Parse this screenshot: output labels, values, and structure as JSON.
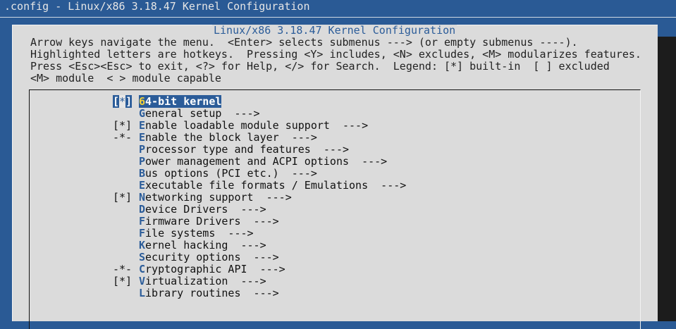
{
  "window": {
    "title": ".config - Linux/x86 3.18.47 Kernel Configuration"
  },
  "dialog": {
    "title": "Linux/x86 3.18.47 Kernel Configuration",
    "help_lines": [
      "Arrow keys navigate the menu.  <Enter> selects submenus ---> (or empty submenus ----).",
      "Highlighted letters are hotkeys.  Pressing <Y> includes, <N> excludes, <M> modularizes features.",
      "Press <Esc><Esc> to exit, <?> for Help, </> for Search.  Legend: [*] built-in  [ ] excluded",
      "<M> module  < > module capable"
    ]
  },
  "menu": {
    "items": [
      {
        "prefix": "[*]",
        "hot": "6",
        "label": "64-bit kernel",
        "suffix": "",
        "selected": true
      },
      {
        "prefix": "",
        "hot": "G",
        "label": "General setup",
        "suffix": "  --->",
        "selected": false
      },
      {
        "prefix": "[*]",
        "hot": "E",
        "label": "Enable loadable module support",
        "suffix": "  --->",
        "selected": false
      },
      {
        "prefix": "-*-",
        "hot": "E",
        "label": "Enable the block layer",
        "suffix": "  --->",
        "selected": false
      },
      {
        "prefix": "",
        "hot": "P",
        "label": "Processor type and features",
        "suffix": "  --->",
        "selected": false
      },
      {
        "prefix": "",
        "hot": "P",
        "label": "Power management and ACPI options",
        "suffix": "  --->",
        "selected": false
      },
      {
        "prefix": "",
        "hot": "B",
        "label": "Bus options (PCI etc.)",
        "suffix": "  --->",
        "selected": false
      },
      {
        "prefix": "",
        "hot": "E",
        "label": "Executable file formats / Emulations",
        "suffix": "  --->",
        "selected": false
      },
      {
        "prefix": "[*]",
        "hot": "N",
        "label": "Networking support",
        "suffix": "  --->",
        "selected": false
      },
      {
        "prefix": "",
        "hot": "D",
        "label": "Device Drivers",
        "suffix": "  --->",
        "selected": false
      },
      {
        "prefix": "",
        "hot": "F",
        "label": "Firmware Drivers",
        "suffix": "  --->",
        "selected": false
      },
      {
        "prefix": "",
        "hot": "F",
        "label": "File systems",
        "suffix": "  --->",
        "selected": false
      },
      {
        "prefix": "",
        "hot": "K",
        "label": "Kernel hacking",
        "suffix": "  --->",
        "selected": false
      },
      {
        "prefix": "",
        "hot": "S",
        "label": "Security options",
        "suffix": "  --->",
        "selected": false
      },
      {
        "prefix": "-*-",
        "hot": "C",
        "label": "Cryptographic API",
        "suffix": "  --->",
        "selected": false
      },
      {
        "prefix": "[*]",
        "hot": "V",
        "label": "Virtualization",
        "suffix": "  --->",
        "selected": false
      },
      {
        "prefix": "",
        "hot": "L",
        "label": "Library routines",
        "suffix": "  --->",
        "selected": false
      }
    ]
  },
  "colors": {
    "background": "#2a5a95",
    "dialog": "#dbdbdb",
    "accent": "#2b5c99",
    "hotkey_selected": "#f2d23a"
  }
}
